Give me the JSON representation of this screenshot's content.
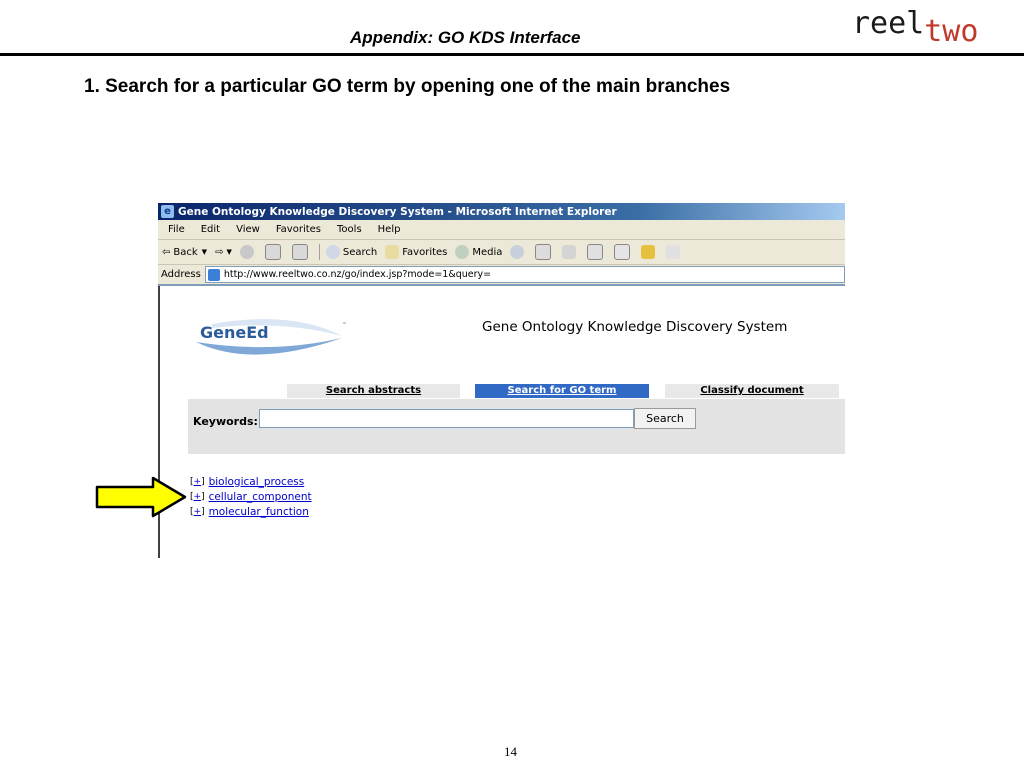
{
  "slide": {
    "header_title": "Appendix: GO KDS Interface",
    "brand_reel": "reel",
    "brand_two": "two",
    "heading": "1. Search for a particular GO term by opening one of the main branches",
    "page_number": "14",
    "colors": {
      "brand_accent": "#c0392b",
      "arrow_fill": "#ffff00"
    }
  },
  "browser": {
    "window_title": "Gene Ontology Knowledge Discovery System - Microsoft Internet Explorer",
    "menu": [
      "File",
      "Edit",
      "View",
      "Favorites",
      "Tools",
      "Help"
    ],
    "toolbar": {
      "back": "Back",
      "search": "Search",
      "favorites": "Favorites",
      "media": "Media"
    },
    "address_label": "Address",
    "address_url": "http://www.reeltwo.co.nz/go/index.jsp?mode=1&query="
  },
  "page": {
    "logo_text": "GeneEd",
    "logo_tm": "™",
    "site_title": "Gene Ontology Knowledge Discovery System",
    "tabs": [
      "Search abstracts",
      "Search for GO term",
      "Classify document"
    ],
    "active_tab": "Search for GO term",
    "keywords_label": "Keywords:",
    "keywords_value": "",
    "search_button": "Search",
    "tree_toggle": "+",
    "tree": [
      "biological_process",
      "cellular_component",
      "molecular_function"
    ]
  }
}
